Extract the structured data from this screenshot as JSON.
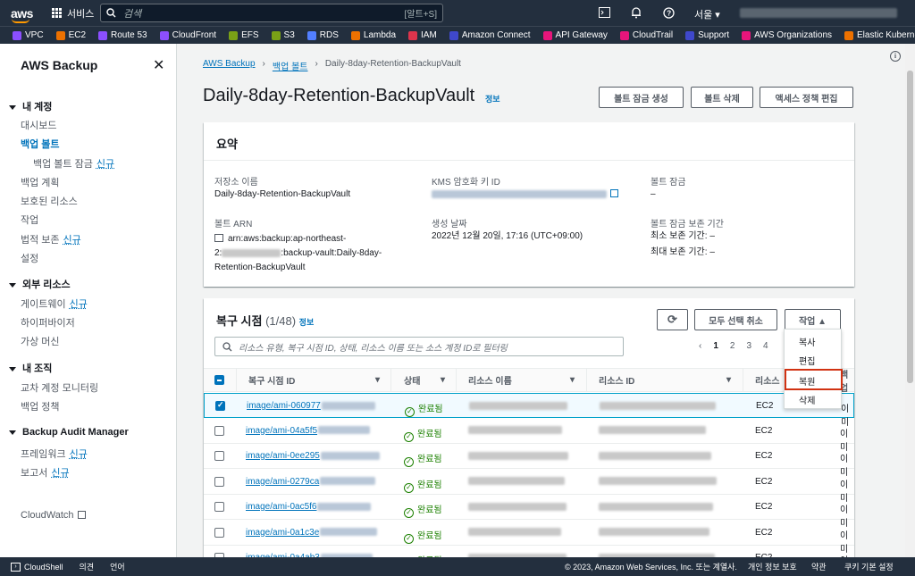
{
  "topnav": {
    "logo": "aws",
    "services_label": "서비스",
    "search_placeholder": "검색",
    "search_shortcut": "[알트+S]",
    "region": "서울 ▾"
  },
  "bookmarks": [
    {
      "label": "VPC",
      "color": "#8c4fff"
    },
    {
      "label": "EC2",
      "color": "#ed7100"
    },
    {
      "label": "Route 53",
      "color": "#8c4fff"
    },
    {
      "label": "CloudFront",
      "color": "#8c4fff"
    },
    {
      "label": "EFS",
      "color": "#7aa116"
    },
    {
      "label": "S3",
      "color": "#7aa116"
    },
    {
      "label": "RDS",
      "color": "#527fff"
    },
    {
      "label": "Lambda",
      "color": "#ed7100"
    },
    {
      "label": "IAM",
      "color": "#dd344c"
    },
    {
      "label": "Amazon Connect",
      "color": "#3f48cc"
    },
    {
      "label": "API Gateway",
      "color": "#e7157b"
    },
    {
      "label": "CloudTrail",
      "color": "#e7157b"
    },
    {
      "label": "Support",
      "color": "#3f48cc"
    },
    {
      "label": "AWS Organizations",
      "color": "#e7157b"
    },
    {
      "label": "Elastic Kubernetes Service",
      "color": "#ed7100"
    }
  ],
  "sidebar": {
    "title": "AWS Backup",
    "sections": {
      "my_account": "내 계정",
      "dashboard": "대시보드",
      "vaults": "백업 볼트",
      "vault_lock": "백업 볼트 잠금",
      "plans": "백업 계획",
      "protected": "보호된 리소스",
      "jobs": "작업",
      "legal_hold": "법적 보존",
      "settings": "설정",
      "external": "외부 리소스",
      "gateway": "게이트웨이",
      "hypervisor": "하이퍼바이저",
      "vm": "가상 머신",
      "org": "내 조직",
      "cross_account": "교차 계정 모니터링",
      "backup_policy": "백업 정책",
      "audit": "Backup Audit Manager",
      "frameworks": "프레임워크",
      "reports": "보고서",
      "cloudwatch": "CloudWatch",
      "new": "신규"
    }
  },
  "breadcrumb": {
    "root": "AWS Backup",
    "vaults": "백업 볼트",
    "current": "Daily-8day-Retention-BackupVault"
  },
  "page": {
    "title": "Daily-8day-Retention-BackupVault",
    "info": "정보",
    "btn_lock": "볼트 잠금 생성",
    "btn_delete": "볼트 삭제",
    "btn_access": "액세스 정책 편집"
  },
  "summary": {
    "heading": "요약",
    "storage_name_label": "저장소 이름",
    "storage_name": "Daily-8day-Retention-BackupVault",
    "arn_label": "볼트 ARN",
    "arn_line1": "arn:aws:backup:ap-northeast-",
    "arn_line2_prefix": "2:",
    "arn_line2_suffix": ":backup-vault:Daily-8day-",
    "arn_line3": "Retention-BackupVault",
    "kms_label": "KMS 암호화 키 ID",
    "created_label": "생성 날짜",
    "created": "2022년 12월 20일, 17:16 (UTC+09:00)",
    "lock_label": "볼트 잠금",
    "lock_value": "–",
    "retention_label": "볼트 잠금 보존 기간",
    "min_retention": "최소 보존 기간: –",
    "max_retention": "최대 보존 기간: –"
  },
  "recovery": {
    "heading": "복구 시점",
    "count": "(1/48)",
    "info": "정보",
    "btn_deselect": "모두 선택 취소",
    "btn_actions": "작업 ▲",
    "filter_placeholder": "리소스 유형, 복구 시점 ID, 상태, 리소스 이름 또는 소스 계정 ID로 필터링",
    "pages": [
      "1",
      "2",
      "3",
      "4"
    ],
    "columns": {
      "id": "복구 시점 ID",
      "status": "상태",
      "resource_name": "리소스 이름",
      "resource_id": "리소스 ID",
      "resource_type": "리소스",
      "backup_type": "백업"
    },
    "rows": [
      {
        "id": "image/ami-060977",
        "status": "완료됨",
        "type": "EC2",
        "backup": "이미"
      },
      {
        "id": "image/ami-04a5f5",
        "status": "완료됨",
        "type": "EC2",
        "backup": "이미"
      },
      {
        "id": "image/ami-0ee295",
        "status": "완료됨",
        "type": "EC2",
        "backup": "이미"
      },
      {
        "id": "image/ami-0279ca",
        "status": "완료됨",
        "type": "EC2",
        "backup": "이미"
      },
      {
        "id": "image/ami-0ac5f6",
        "status": "완료됨",
        "type": "EC2",
        "backup": "이미"
      },
      {
        "id": "image/ami-0a1c3e",
        "status": "완료됨",
        "type": "EC2",
        "backup": "이미"
      },
      {
        "id": "image/ami-0a4ab3",
        "status": "완료됨",
        "type": "EC2",
        "backup": "이미"
      }
    ],
    "menu": [
      "복사",
      "편집",
      "복원",
      "삭제"
    ]
  },
  "footer": {
    "cloudshell": "CloudShell",
    "feedback": "의견",
    "language": "언어",
    "copyright": "© 2023, Amazon Web Services, Inc. 또는 계열사.",
    "privacy": "개인 정보 보호",
    "terms": "약관",
    "cookies": "쿠키 기본 설정"
  }
}
